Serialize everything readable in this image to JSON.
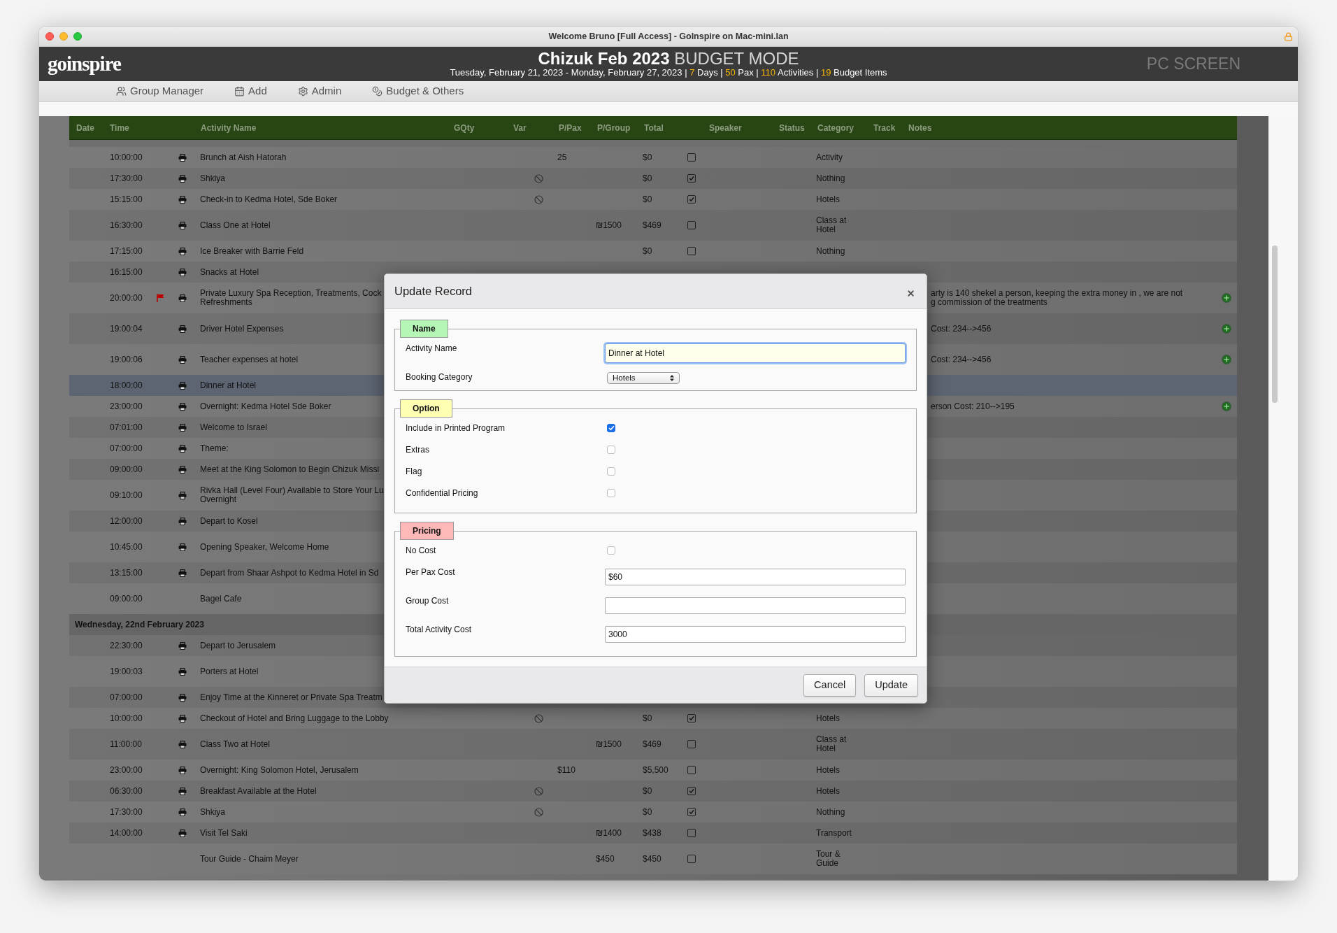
{
  "window": {
    "title": "Welcome Bruno [Full Access] - GoInspire on Mac-mini.lan"
  },
  "header": {
    "logo": "goinspire",
    "title": "Chizuk Feb 2023",
    "mode": "BUDGET MODE",
    "subtitle": [
      {
        "kind": "text",
        "text": "Tuesday, February 21, 2023 - Monday, February 27, 2023 |"
      },
      {
        "kind": "number",
        "text": "7"
      },
      {
        "kind": "text",
        "text": "Days |"
      },
      {
        "kind": "number",
        "text": "50"
      },
      {
        "kind": "text",
        "text": "Pax |"
      },
      {
        "kind": "number",
        "text": "110"
      },
      {
        "kind": "text",
        "text": "Activities |"
      },
      {
        "kind": "number",
        "text": "19"
      },
      {
        "kind": "text",
        "text": "Budget Items"
      }
    ],
    "screen_label": "PC SCREEN"
  },
  "nav": [
    {
      "kind": "group",
      "label": "Group Manager"
    },
    {
      "kind": "calendar",
      "label": "Add"
    },
    {
      "kind": "gear",
      "label": "Admin"
    },
    {
      "kind": "coins",
      "label": "Budget & Others"
    }
  ],
  "table": {
    "columns": [
      "Date",
      "Time",
      "Activity Name",
      "GQty",
      "Var",
      "P/Pax",
      "P/Group",
      "Total",
      "Speaker",
      "Status",
      "Category",
      "Track",
      "Notes"
    ],
    "rows": [
      {
        "kind": "activity",
        "time": "10:00:00",
        "flagged": false,
        "printed": true,
        "selected": false,
        "add_button": false,
        "name": "Brunch at Aish Hatorah",
        "var_icon": false,
        "ppax": "25",
        "total": "$0",
        "checked": false,
        "category": "Activity"
      },
      {
        "kind": "activity",
        "time": "17:30:00",
        "flagged": false,
        "printed": true,
        "selected": false,
        "add_button": false,
        "name": "Shkiya",
        "var_icon": true,
        "total": "$0",
        "checked": true,
        "category": "Nothing"
      },
      {
        "kind": "activity",
        "time": "15:15:00",
        "flagged": false,
        "printed": true,
        "selected": false,
        "add_button": false,
        "name": "Check-in to Kedma Hotel, Sde Boker",
        "var_icon": true,
        "total": "$0",
        "checked": true,
        "category": "Hotels"
      },
      {
        "kind": "activity",
        "time": "16:30:00",
        "flagged": false,
        "printed": true,
        "selected": false,
        "add_button": false,
        "name": "Class One at Hotel",
        "var_icon": false,
        "pgroup": "₪1500",
        "total": "$469",
        "checked": false,
        "category": "Class at Hotel"
      },
      {
        "kind": "activity",
        "time": "17:15:00",
        "flagged": false,
        "printed": true,
        "selected": false,
        "add_button": false,
        "name": "Ice Breaker with Barrie Feld",
        "var_icon": false,
        "total": "$0",
        "checked": false,
        "category": "Nothing"
      },
      {
        "kind": "activity",
        "time": "16:15:00",
        "flagged": false,
        "printed": true,
        "selected": false,
        "add_button": false,
        "name": "Snacks at Hotel"
      },
      {
        "kind": "activity",
        "time": "20:00:00",
        "flagged": true,
        "printed": true,
        "selected": false,
        "add_button": true,
        "name": "Private Luxury Spa Reception, Treatments, Cock\nRefreshments",
        "notes": "arty is 140 shekel a person, keeping the extra money in , we are not\ng commission of the treatments"
      },
      {
        "kind": "activity",
        "time": "19:00:04",
        "flagged": false,
        "printed": true,
        "selected": false,
        "add_button": true,
        "name": "Driver Hotel Expenses",
        "notes": "Cost: 234-->456"
      },
      {
        "kind": "activity",
        "time": "19:00:06",
        "flagged": false,
        "printed": true,
        "selected": false,
        "add_button": true,
        "name": "Teacher expenses at hotel",
        "notes": "Cost: 234-->456"
      },
      {
        "kind": "activity",
        "time": "18:00:00",
        "flagged": false,
        "printed": true,
        "selected": true,
        "add_button": false,
        "name": "Dinner at Hotel"
      },
      {
        "kind": "activity",
        "time": "23:00:00",
        "flagged": false,
        "printed": true,
        "selected": false,
        "add_button": true,
        "name": "Overnight: Kedma Hotel Sde Boker",
        "notes": "erson Cost: 210-->195"
      },
      {
        "kind": "activity",
        "time": "07:01:00",
        "flagged": false,
        "printed": true,
        "selected": false,
        "add_button": false,
        "name": "Welcome to Israel"
      },
      {
        "kind": "activity",
        "time": "07:00:00",
        "flagged": false,
        "printed": true,
        "selected": false,
        "add_button": false,
        "name": "Theme:"
      },
      {
        "kind": "activity",
        "time": "09:00:00",
        "flagged": false,
        "printed": true,
        "selected": false,
        "add_button": false,
        "name": "Meet at the King Solomon to Begin Chizuk Missi"
      },
      {
        "kind": "activity",
        "time": "09:10:00",
        "flagged": false,
        "printed": true,
        "selected": false,
        "add_button": false,
        "name": "Rivka Hall (Level Four) Available to Store Your Lu\nOvernight"
      },
      {
        "kind": "activity",
        "time": "12:00:00",
        "flagged": false,
        "printed": true,
        "selected": false,
        "add_button": false,
        "name": "Depart to Kosel"
      },
      {
        "kind": "activity",
        "time": "10:45:00",
        "flagged": false,
        "printed": true,
        "selected": false,
        "add_button": false,
        "name": "Opening Speaker, Welcome Home"
      },
      {
        "kind": "activity",
        "time": "13:15:00",
        "flagged": false,
        "printed": true,
        "selected": false,
        "add_button": false,
        "name": "Depart from Shaar Ashpot to Kedma Hotel in Sd"
      },
      {
        "kind": "activity",
        "time": "09:00:00",
        "flagged": false,
        "printed": false,
        "selected": false,
        "add_button": false,
        "name": "Bagel Cafe"
      },
      {
        "kind": "group",
        "label": "Wednesday, 22nd February 2023"
      },
      {
        "kind": "activity",
        "time": "22:30:00",
        "flagged": false,
        "printed": true,
        "selected": false,
        "add_button": false,
        "name": "Depart to Jerusalem"
      },
      {
        "kind": "activity",
        "time": "19:00:03",
        "flagged": false,
        "printed": true,
        "selected": false,
        "add_button": false,
        "name": "Porters at Hotel"
      },
      {
        "kind": "activity",
        "time": "07:00:00",
        "flagged": false,
        "printed": true,
        "selected": false,
        "add_button": false,
        "name": "Enjoy Time at the Kinneret or Private Spa Treatm"
      },
      {
        "kind": "activity",
        "time": "10:00:00",
        "flagged": false,
        "printed": true,
        "selected": false,
        "add_button": false,
        "name": "Checkout of Hotel and Bring Luggage to the Lobby",
        "var_icon": true,
        "total": "$0",
        "checked": true,
        "category": "Hotels"
      },
      {
        "kind": "activity",
        "time": "11:00:00",
        "flagged": false,
        "printed": true,
        "selected": false,
        "add_button": false,
        "name": "Class Two at Hotel",
        "var_icon": false,
        "pgroup": "₪1500",
        "total": "$469",
        "checked": false,
        "category": "Class at Hotel"
      },
      {
        "kind": "activity",
        "time": "23:00:00",
        "flagged": false,
        "printed": true,
        "selected": false,
        "add_button": false,
        "name": "Overnight: King Solomon Hotel, Jerusalem",
        "var_icon": false,
        "ppax": "$110",
        "total": "$5,500",
        "checked": false,
        "category": "Hotels"
      },
      {
        "kind": "activity",
        "time": "06:30:00",
        "flagged": false,
        "printed": true,
        "selected": false,
        "add_button": false,
        "name": "Breakfast Available at the Hotel",
        "var_icon": true,
        "total": "$0",
        "checked": true,
        "category": "Hotels"
      },
      {
        "kind": "activity",
        "time": "17:30:00",
        "flagged": false,
        "printed": true,
        "selected": false,
        "add_button": false,
        "name": "Shkiya",
        "var_icon": true,
        "total": "$0",
        "checked": true,
        "category": "Nothing"
      },
      {
        "kind": "activity",
        "time": "14:00:00",
        "flagged": false,
        "printed": true,
        "selected": false,
        "add_button": false,
        "name": "Visit Tel Saki",
        "var_icon": false,
        "pgroup": "₪1400",
        "total": "$438",
        "checked": false,
        "category": "Transport"
      },
      {
        "kind": "activity",
        "flagged": false,
        "printed": false,
        "selected": false,
        "add_button": false,
        "name": "Tour Guide - Chaim Meyer",
        "var_icon": false,
        "pgroup": "$450",
        "total": "$450",
        "checked": false,
        "category": "Tour & Guide"
      }
    ]
  },
  "dialog": {
    "title": "Update Record",
    "sections": [
      {
        "legend": "Name",
        "color": "#b5f5b5",
        "fields": [
          {
            "kind": "text",
            "label": "Activity Name",
            "value": "Dinner at Hotel",
            "focused": true
          },
          {
            "kind": "select",
            "label": "Booking Category",
            "value": "Hotels"
          }
        ]
      },
      {
        "legend": "Option",
        "color": "#ffffb3",
        "fields": [
          {
            "kind": "checkbox",
            "label": "Include in Printed Program",
            "checked": true
          },
          {
            "kind": "checkbox",
            "label": "Extras",
            "checked": false
          },
          {
            "kind": "checkbox",
            "label": "Flag",
            "checked": false
          },
          {
            "kind": "checkbox",
            "label": "Confidential Pricing",
            "checked": false
          }
        ]
      },
      {
        "legend": "Pricing",
        "color": "#ffb8b8",
        "fields": [
          {
            "kind": "checkbox",
            "label": "No Cost",
            "checked": false
          },
          {
            "kind": "text",
            "label": "Per Pax Cost",
            "value": "$60",
            "focused": false
          },
          {
            "kind": "text",
            "label": "Group Cost",
            "focused": false
          },
          {
            "kind": "text",
            "label": "Total Activity Cost",
            "value": "3000",
            "focused": false
          }
        ]
      }
    ],
    "buttons": [
      "Cancel",
      "Update"
    ]
  }
}
